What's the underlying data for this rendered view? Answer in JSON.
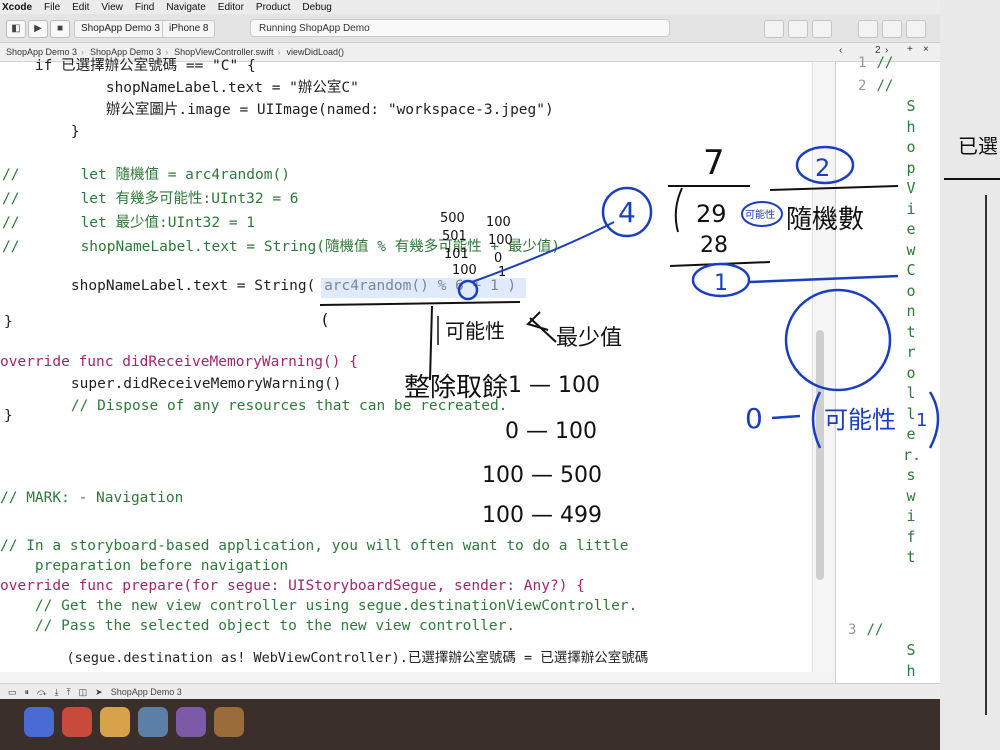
{
  "menubar": [
    "Xcode",
    "File",
    "Edit",
    "View",
    "Find",
    "Navigate",
    "Editor",
    "Product",
    "Debug"
  ],
  "toolbar": {
    "scheme": "ShopApp Demo 3",
    "device": "iPhone 8",
    "activity": "Running ShopApp Demo"
  },
  "jumpbar": [
    "ShopApp Demo 3",
    "ShopApp Demo 3",
    "ShopViewController.swift",
    "viewDidLoad()"
  ],
  "code_lines": [
    "    if 已選擇辦公室號碼 == \"C\" {",
    "        shopNameLabel.text = \"辦公室C\"",
    "        辦公室圖片.image = UIImage(named: \"workspace-3.jpeg\")",
    "    }",
    "",
    "//       let 隨機值 = arc4random()",
    "//       let 有幾多可能性:UInt32 = 6",
    "//       let 最少值:UInt32 = 1",
    "//       shopNameLabel.text = String(隨機值 % 有幾多可能性 + 最少值)",
    "",
    "    shopNameLabel.text = String( arc4random() % 6 + 1 )",
    "",
    "}",
    "",
    "override func didReceiveMemoryWarning() {",
    "    super.didReceiveMemoryWarning()",
    "    // Dispose of any resources that can be recreated.",
    "}",
    "",
    "",
    "",
    "// MARK: - Navigation",
    "",
    "// In a storyboard-based application, you will often want to do a little",
    "    preparation before navigation",
    "override func prepare(for segue: UIStoryboardSegue, sender: Any?) {",
    "    // Get the new view controller using segue.destinationViewController.",
    "    // Pass the selected object to the new view controller.",
    "",
    "    (segue.destination as! WebViewController).已選擇辦公室號碼 = 已選擇辦公室號碼"
  ],
  "assistant": {
    "counter": "2",
    "line1": "//",
    "line2": "//",
    "line3": "//",
    "num1": "1",
    "num2": "2",
    "num3": "3",
    "vertical_filename": "ShopViewController.swift",
    "vertical_next": "ShopA"
  },
  "statusbar": {
    "target": "ShopApp Demo 3"
  },
  "handwriting": {
    "n500": "500",
    "n100a": "100",
    "n501": "501",
    "n100b": "100",
    "n101": "101",
    "n0": "0",
    "n100c": "100",
    "n1": "1",
    "paren": "(",
    "possibility": "可能性",
    "minimum": "最少值",
    "remainder": "整除取餘",
    "range1": "1 — 100",
    "range2": "0 — 100",
    "range3": "100 — 500",
    "range4": "100 — 499",
    "circle4": "4",
    "circle2": "2",
    "seven": "7",
    "twentynine": "29",
    "twentyeight": "28",
    "circle1": "1",
    "random_num": "隨機數",
    "possible_small": "可能性",
    "zero": "0",
    "possible_big": "可能性",
    "one": "1",
    "whiteboard": "已選"
  }
}
